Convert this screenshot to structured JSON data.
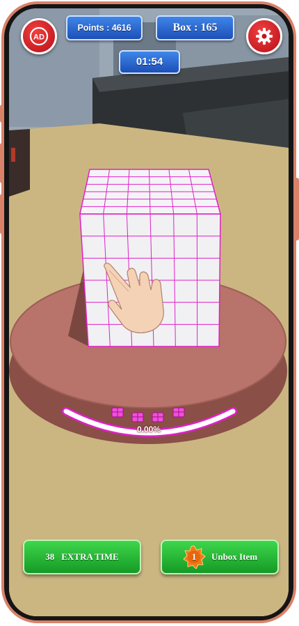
{
  "hud": {
    "points_label": "Points : 4616",
    "box_label": "Box : 165",
    "timer": "01:54",
    "ad_button_icon": "ad-icon",
    "settings_button_icon": "gear-icon"
  },
  "progress": {
    "percent_text": "0.00%",
    "value": 0.0
  },
  "buttons": {
    "extra_time_count": "38",
    "extra_time_label": "EXTRA TIME",
    "unbox_badge": "1",
    "unbox_label": "Unbox Item"
  },
  "colors": {
    "accent_pink": "#e01fc8",
    "hud_blue": "#2b63d1",
    "button_green": "#1fb02f",
    "settings_red": "#d61a23",
    "frame": "#d9826a"
  }
}
